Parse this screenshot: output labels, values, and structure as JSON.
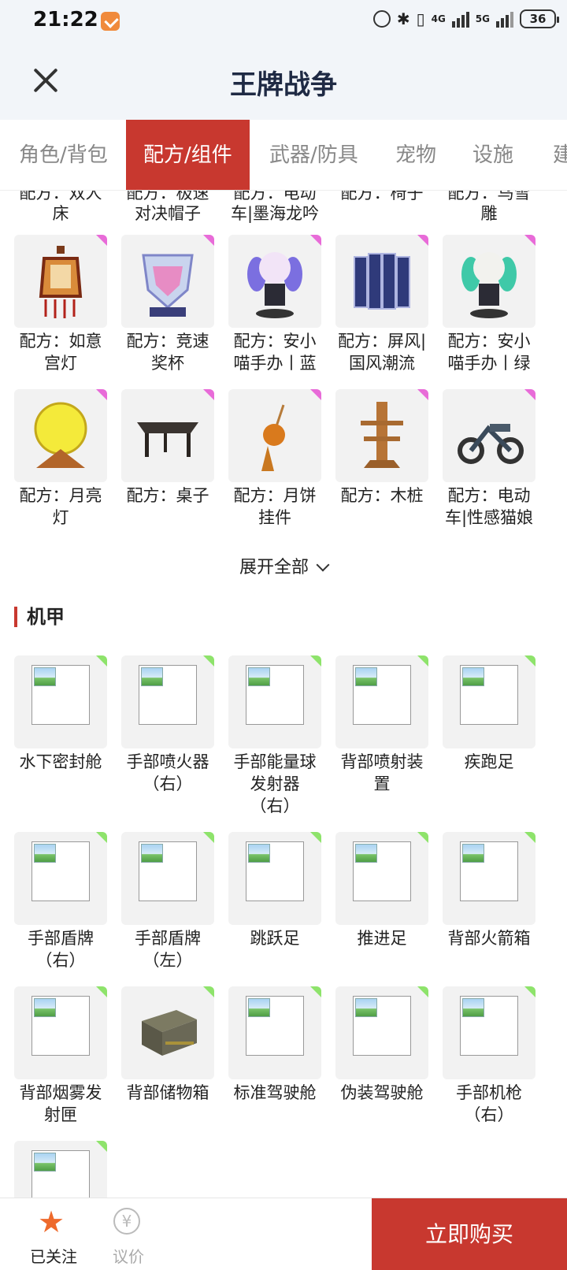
{
  "status_bar": {
    "time": "21:22",
    "battery": "36",
    "net1": "4G",
    "net2": "5G"
  },
  "header": {
    "title": "王牌战争"
  },
  "tabs": [
    "角色/背包",
    "配方/组件",
    "武器/防具",
    "宠物",
    "设施",
    "建"
  ],
  "partial_row": [
    {
      "line1": "配方：双人",
      "line2": "床"
    },
    {
      "line1": "配方：极速",
      "line2": "对决帽子"
    },
    {
      "line1": "配方：电动",
      "line2": "车|墨海龙吟"
    },
    {
      "line1": "配方：椅子",
      "line2": ""
    },
    {
      "line1": "配方：鸟雪",
      "line2": "雕"
    }
  ],
  "recipe_row1": [
    {
      "line1": "配方：如意",
      "line2": "宫灯",
      "icon": "lantern-icon"
    },
    {
      "line1": "配方：竞速",
      "line2": "奖杯",
      "icon": "trophy-icon"
    },
    {
      "line1": "配方：安小",
      "line2": "喵手办丨蓝",
      "icon": "figure-blue-icon"
    },
    {
      "line1": "配方：屏风|",
      "line2": "国风潮流",
      "icon": "screen-icon"
    },
    {
      "line1": "配方：安小",
      "line2": "喵手办丨绿",
      "icon": "figure-green-icon"
    }
  ],
  "recipe_row2": [
    {
      "line1": "配方：月亮",
      "line2": "灯",
      "icon": "moon-lamp-icon"
    },
    {
      "line1": "配方：桌子",
      "line2": "",
      "icon": "table-icon"
    },
    {
      "line1": "配方：月饼",
      "line2": "挂件",
      "icon": "mooncake-pendant-icon"
    },
    {
      "line1": "配方：木桩",
      "line2": "",
      "icon": "wooden-dummy-icon"
    },
    {
      "line1": "配方：电动",
      "line2": "车|性感猫娘",
      "icon": "motorbike-icon"
    }
  ],
  "expand_label": "展开全部",
  "section": {
    "title": "机甲"
  },
  "mecha_row1": [
    {
      "line1": "水下密封舱",
      "line2": "",
      "line3": ""
    },
    {
      "line1": "手部喷火器",
      "line2": "（右）",
      "line3": ""
    },
    {
      "line1": "手部能量球",
      "line2": "发射器",
      "line3": "（右）"
    },
    {
      "line1": "背部喷射装",
      "line2": "置",
      "line3": ""
    },
    {
      "line1": "疾跑足",
      "line2": "",
      "line3": ""
    }
  ],
  "mecha_row2": [
    {
      "line1": "手部盾牌",
      "line2": "（右）"
    },
    {
      "line1": "手部盾牌",
      "line2": "（左）"
    },
    {
      "line1": "跳跃足",
      "line2": ""
    },
    {
      "line1": "推进足",
      "line2": ""
    },
    {
      "line1": "背部火箭箱",
      "line2": ""
    }
  ],
  "mecha_row3": [
    {
      "line1": "背部烟雾发",
      "line2": "射匣"
    },
    {
      "line1": "背部储物箱",
      "line2": ""
    },
    {
      "line1": "标准驾驶舱",
      "line2": ""
    },
    {
      "line1": "伪装驾驶舱",
      "line2": ""
    },
    {
      "line1": "手部机枪",
      "line2": "（右）"
    }
  ],
  "bottom_bar": {
    "follow_label": "已关注",
    "bargain_label": "议价",
    "buy_label": "立即购买"
  },
  "colors": {
    "accent": "#c8382f",
    "pink_corner": "#e86bd8",
    "green_corner": "#8ee36b",
    "star": "#ee6a2c"
  }
}
